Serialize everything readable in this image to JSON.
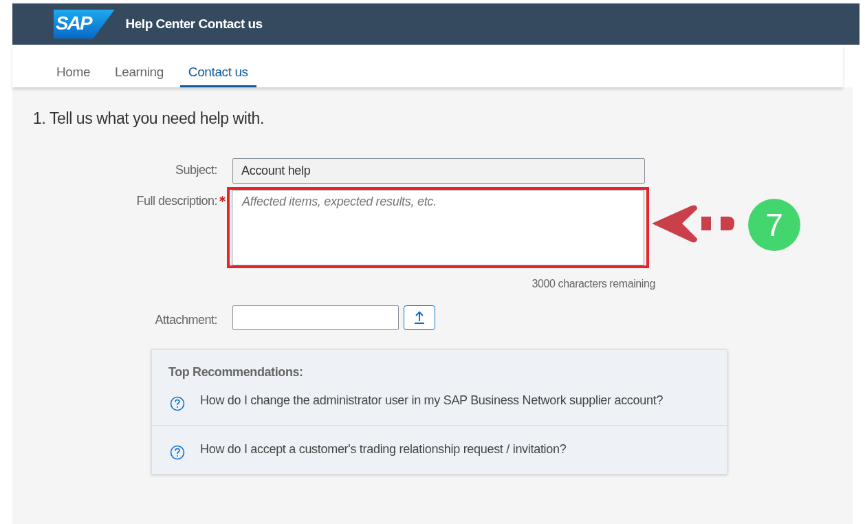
{
  "header": {
    "logo": "SAP",
    "title": "Help Center Contact us"
  },
  "tabs": [
    {
      "label": "Home",
      "selected": false
    },
    {
      "label": "Learning",
      "selected": false
    },
    {
      "label": "Contact us",
      "selected": true
    }
  ],
  "section_title": "1. Tell us what you need help with.",
  "form": {
    "subject": {
      "label": "Subject:",
      "value": "Account help"
    },
    "description": {
      "label": "Full description:",
      "required": true,
      "placeholder": "Affected items, expected results, etc.",
      "highlighted": true,
      "counter": "3000 characters remaining"
    },
    "attachment": {
      "label": "Attachment:"
    }
  },
  "annotation": {
    "number": "7"
  },
  "recommendations": {
    "title": "Top Recommendations:",
    "items": [
      {
        "text": "How do I change the administrator user in my SAP Business Network supplier account?"
      },
      {
        "text": "How do I accept a customer's trading relationship request / invitation?"
      }
    ]
  }
}
